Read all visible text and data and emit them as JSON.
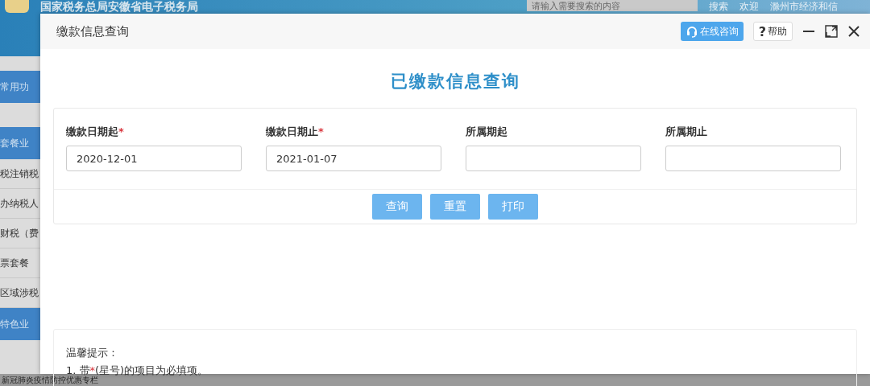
{
  "background": {
    "site_title": "国家税务总局安徽省电子税务局",
    "search": {
      "placeholder": "请输入需要搜索的内容"
    },
    "search_button": "搜索",
    "welcome": "欢迎",
    "user": "滁州市经济和信",
    "sidebar": [
      {
        "label": "常用功",
        "kind": "group"
      },
      {
        "label": "套餐业",
        "kind": "group"
      },
      {
        "label": "税注销税",
        "kind": "item"
      },
      {
        "label": "办纳税人",
        "kind": "item"
      },
      {
        "label": "财税（费",
        "kind": "item"
      },
      {
        "label": "票套餐",
        "kind": "item"
      },
      {
        "label": "区域涉税",
        "kind": "item"
      },
      {
        "label": "特色业",
        "kind": "group"
      }
    ],
    "bottom_bar": "新冠肺炎疫情防控优惠专栏"
  },
  "dialog": {
    "title": "缴款信息查询",
    "consult_button": "在线咨询",
    "help_button": {
      "icon": "?",
      "label": "帮助"
    },
    "heading": "已缴款信息查询",
    "required_mark": "*",
    "fields": [
      {
        "label": "缴款日期起",
        "required": true,
        "value": "2020-12-01"
      },
      {
        "label": "缴款日期止",
        "required": true,
        "value": "2021-01-07"
      },
      {
        "label": "所属期起",
        "required": false
      },
      {
        "label": "所属期止",
        "required": false
      }
    ],
    "buttons": [
      "查询",
      "重置",
      "打印"
    ],
    "tips": {
      "title": "温馨提示：",
      "line_prefix": "1. 带",
      "line_suffix": "(星号)的项目为必填项。"
    }
  }
}
